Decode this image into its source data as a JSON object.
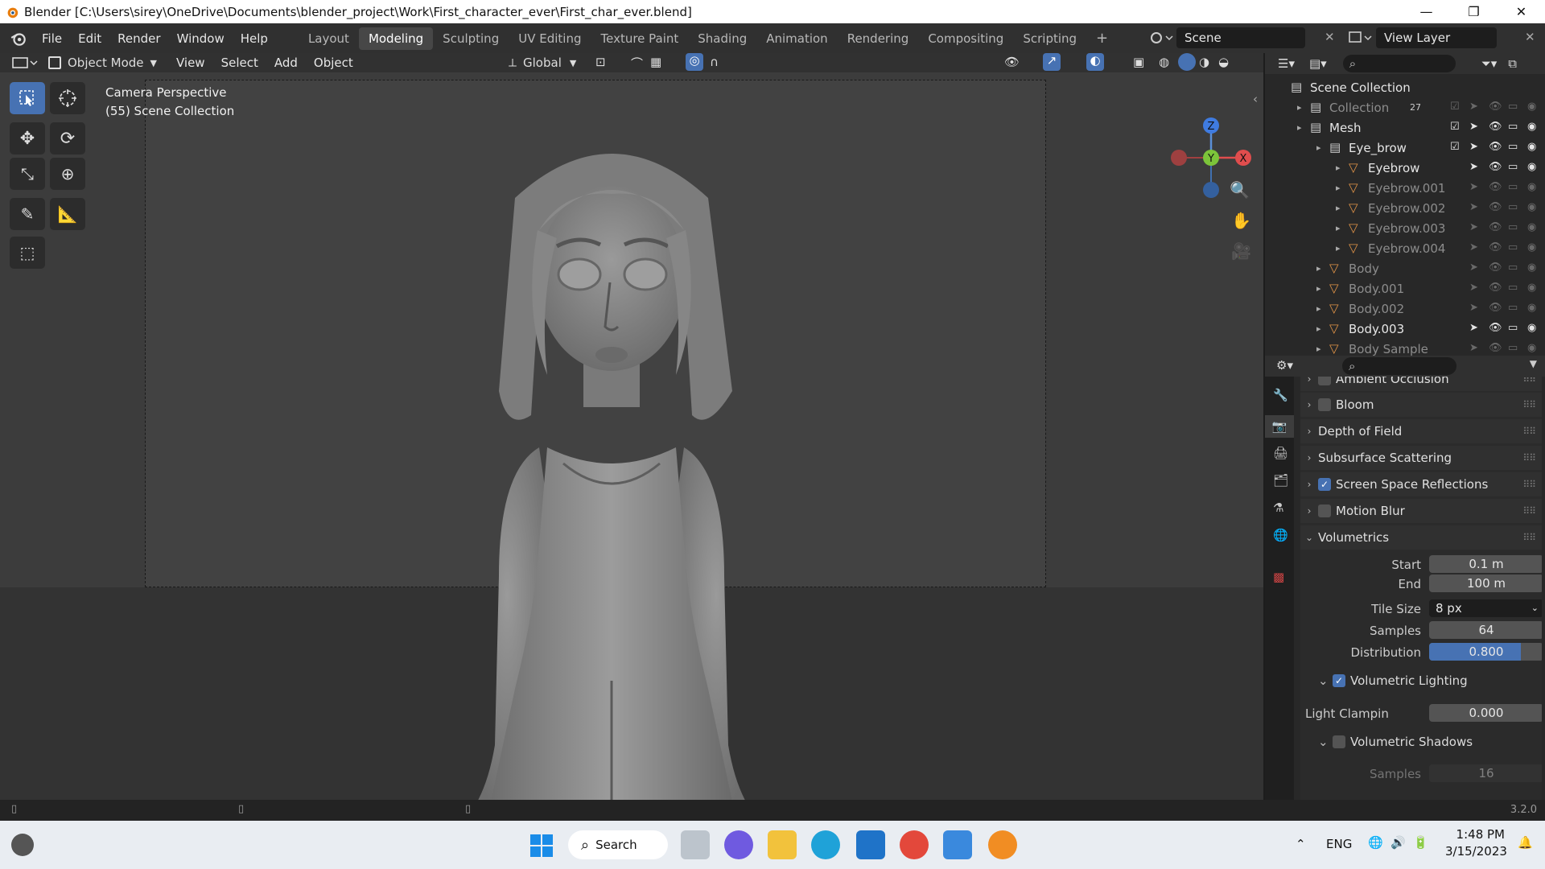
{
  "window": {
    "title": "Blender [C:\\Users\\sirey\\OneDrive\\Documents\\blender_project\\Work\\First_character_ever\\First_char_ever.blend]",
    "controls": [
      "—",
      "❐",
      "✕"
    ]
  },
  "menu": [
    "File",
    "Edit",
    "Render",
    "Window",
    "Help"
  ],
  "workspaces": [
    {
      "label": "Layout",
      "active": false
    },
    {
      "label": "Modeling",
      "active": true
    },
    {
      "label": "Sculpting",
      "active": false
    },
    {
      "label": "UV Editing",
      "active": false
    },
    {
      "label": "Texture Paint",
      "active": false
    },
    {
      "label": "Shading",
      "active": false
    },
    {
      "label": "Animation",
      "active": false
    },
    {
      "label": "Rendering",
      "active": false
    },
    {
      "label": "Compositing",
      "active": false
    },
    {
      "label": "Scripting",
      "active": false
    }
  ],
  "add_workspace": "+",
  "scene": {
    "label": "Scene"
  },
  "view_layer": {
    "label": "View Layer"
  },
  "viewport_header": {
    "mode": "Object Mode",
    "menus": [
      "View",
      "Select",
      "Add",
      "Object"
    ],
    "transform": "Global"
  },
  "viewport": {
    "overlay_line1": "Camera Perspective",
    "overlay_line2": "(55) Scene Collection",
    "gizmo": {
      "z": "Z",
      "y": "Y",
      "x": "X"
    }
  },
  "outliner": {
    "search_placeholder": "",
    "rows": [
      {
        "label": "Scene Collection",
        "type": "scene",
        "indent": 0,
        "dim": false
      },
      {
        "label": "Collection",
        "type": "collection",
        "indent": 1,
        "dim": true,
        "badge": "27"
      },
      {
        "label": "Mesh",
        "type": "collection",
        "indent": 1,
        "dim": false
      },
      {
        "label": "Eye_brow",
        "type": "collection",
        "indent": 2,
        "dim": false
      },
      {
        "label": "Eyebrow",
        "type": "mesh",
        "indent": 3,
        "dim": false
      },
      {
        "label": "Eyebrow.001",
        "type": "mesh",
        "indent": 3,
        "dim": true
      },
      {
        "label": "Eyebrow.002",
        "type": "mesh",
        "indent": 3,
        "dim": true
      },
      {
        "label": "Eyebrow.003",
        "type": "mesh",
        "indent": 3,
        "dim": true
      },
      {
        "label": "Eyebrow.004",
        "type": "mesh",
        "indent": 3,
        "dim": true
      },
      {
        "label": "Body",
        "type": "mesh",
        "indent": 2,
        "dim": true
      },
      {
        "label": "Body.001",
        "type": "mesh",
        "indent": 2,
        "dim": true
      },
      {
        "label": "Body.002",
        "type": "mesh",
        "indent": 2,
        "dim": true
      },
      {
        "label": "Body.003",
        "type": "mesh",
        "indent": 2,
        "dim": false
      },
      {
        "label": "Body Sample",
        "type": "mesh",
        "indent": 2,
        "dim": true
      }
    ]
  },
  "properties": {
    "search_placeholder": "",
    "sections": {
      "ambient_occlusion": "Ambient Occlusion",
      "bloom": "Bloom",
      "depth_of_field": "Depth of Field",
      "subsurface": "Subsurface Scattering",
      "ssr": "Screen Space Reflections",
      "motion_blur": "Motion Blur",
      "volumetrics": "Volumetrics"
    },
    "ssr_enabled": true,
    "bloom_enabled": false,
    "motion_blur_enabled": false,
    "fields": {
      "start_label": "Start",
      "start_value": "0.1 m",
      "end_label": "End",
      "end_value": "100 m",
      "tile_label": "Tile Size",
      "tile_value": "8 px",
      "samples_label": "Samples",
      "samples_value": "64",
      "dist_label": "Distribution",
      "dist_value": "0.800",
      "dist_fraction": 0.8,
      "vol_lighting": "Volumetric Lighting",
      "vol_lighting_enabled": true,
      "clamp_label": "Light Clampin",
      "clamp_value": "0.000",
      "vol_shadows": "Volumetric Shadows",
      "vol_shadows_enabled": false,
      "shadow_samples_label": "Samples",
      "shadow_samples_value": "16"
    }
  },
  "status": {
    "version": "3.2.0"
  },
  "taskbar": {
    "search": "Search",
    "lang": "ENG",
    "time": "1:48 PM",
    "date": "3/15/2023"
  }
}
